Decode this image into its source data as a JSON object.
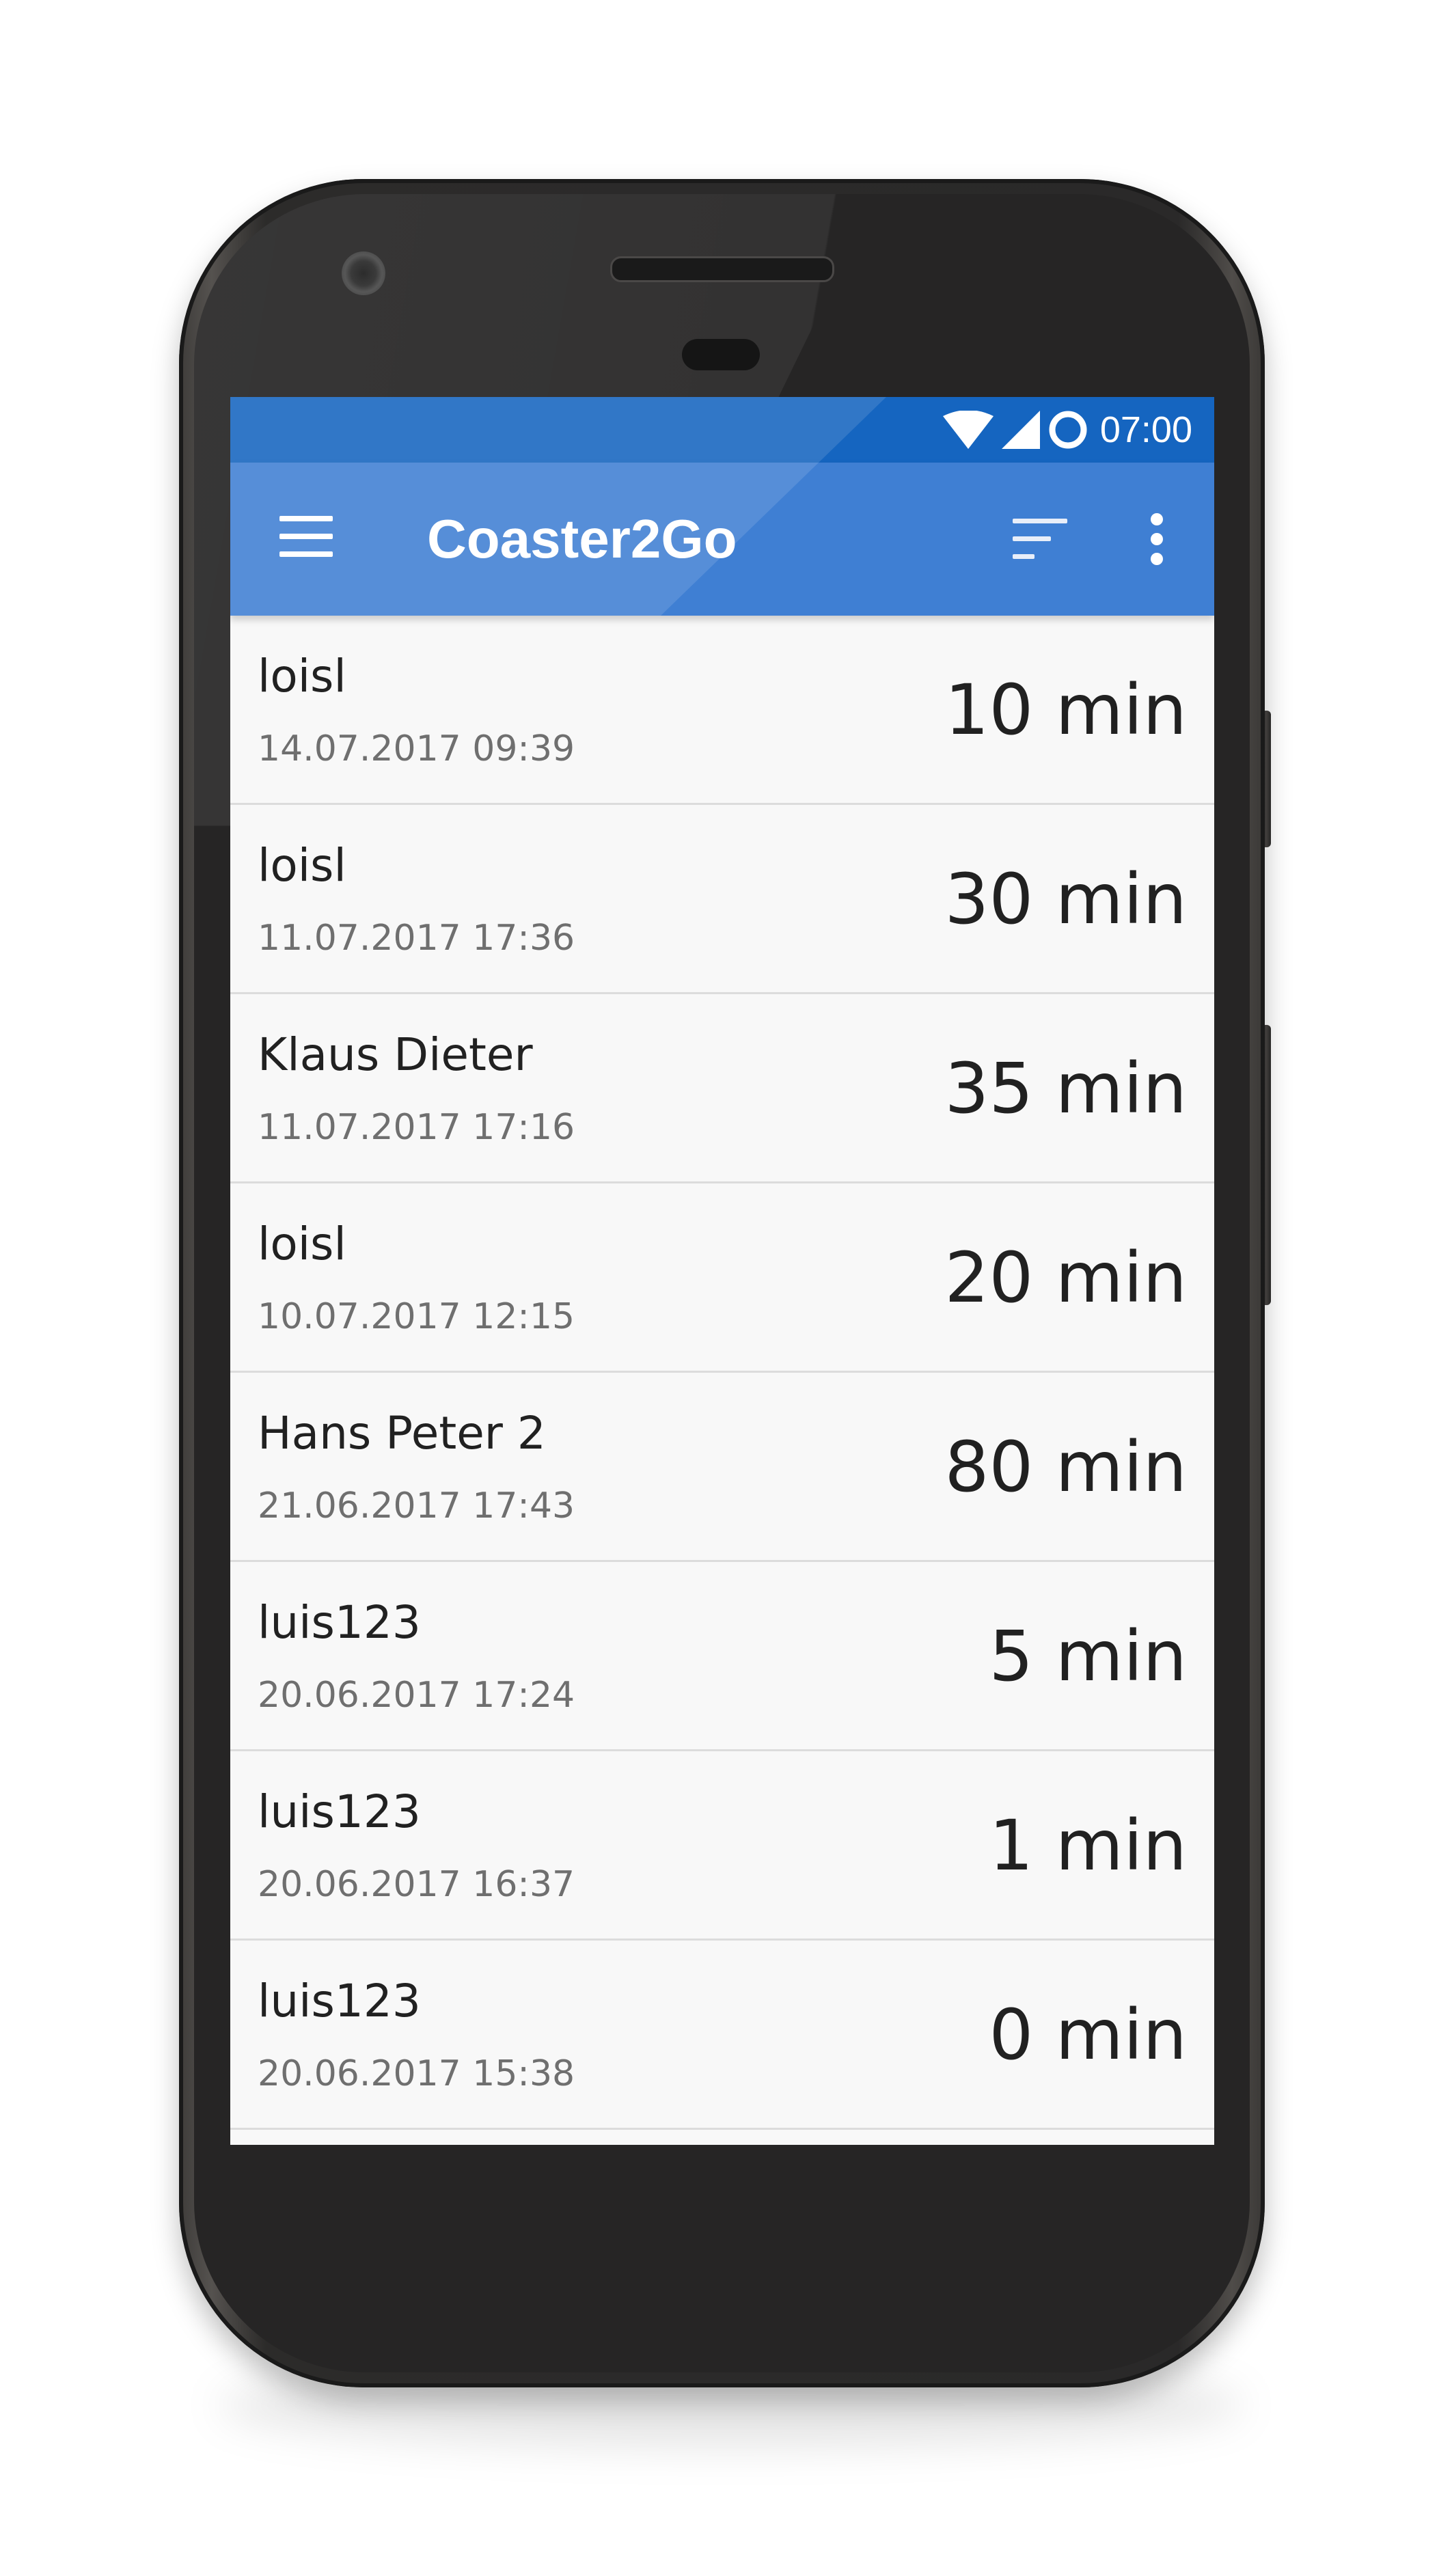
{
  "status_bar": {
    "time": "07:00",
    "icons": [
      "wifi-icon",
      "cell-signal-icon",
      "ring-status-icon"
    ],
    "color": "#1565c0"
  },
  "app_bar": {
    "title": "Coaster2Go",
    "color": "#3f7fd3",
    "icons": [
      "menu-icon",
      "sort-icon",
      "overflow-menu-icon"
    ]
  },
  "entries": [
    {
      "name": "loisl",
      "date": "14.07.2017 09:39",
      "duration": "10 min"
    },
    {
      "name": "loisl",
      "date": "11.07.2017 17:36",
      "duration": "30 min"
    },
    {
      "name": "Klaus Dieter",
      "date": "11.07.2017 17:16",
      "duration": "35 min"
    },
    {
      "name": "loisl",
      "date": "10.07.2017 12:15",
      "duration": "20 min"
    },
    {
      "name": "Hans Peter 2",
      "date": "21.06.2017 17:43",
      "duration": "80 min"
    },
    {
      "name": "luis123",
      "date": "20.06.2017 17:24",
      "duration": "5 min"
    },
    {
      "name": "luis123",
      "date": "20.06.2017 16:37",
      "duration": "1 min"
    },
    {
      "name": "luis123",
      "date": "20.06.2017 15:38",
      "duration": "0 min"
    }
  ]
}
